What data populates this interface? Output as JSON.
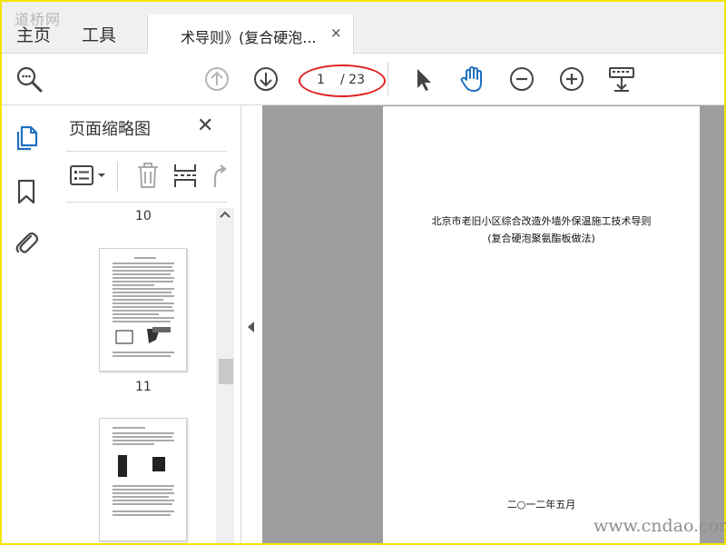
{
  "watermark_top": "道桥网",
  "watermark_bottom": "www.cndao.com",
  "tabs": {
    "home": "主页",
    "tools": "工具",
    "document": "术导则》(复合硬泡...",
    "close": "×"
  },
  "toolbar": {
    "page_current": "1",
    "page_total": "/ 23",
    "icons": [
      "zoom-search-icon",
      "page-up-icon",
      "page-down-icon",
      "select-cursor-icon",
      "hand-tool-icon",
      "zoom-out-icon",
      "zoom-in-icon",
      "keyboard-scroll-icon"
    ]
  },
  "thumbnail_panel": {
    "title": "页面缩略图",
    "close": "✕",
    "labels": [
      "10",
      "11"
    ]
  },
  "document": {
    "title": "北京市老旧小区综合改造外墙外保温施工技术导则",
    "subtitle": "(复合硬泡聚氨酯板做法)",
    "date": "二○一二年五月"
  },
  "colors": {
    "frame": "#f2e400",
    "accent": "#1f6fc1",
    "annotation": "#e02020",
    "doc_background": "#9e9e9e"
  }
}
